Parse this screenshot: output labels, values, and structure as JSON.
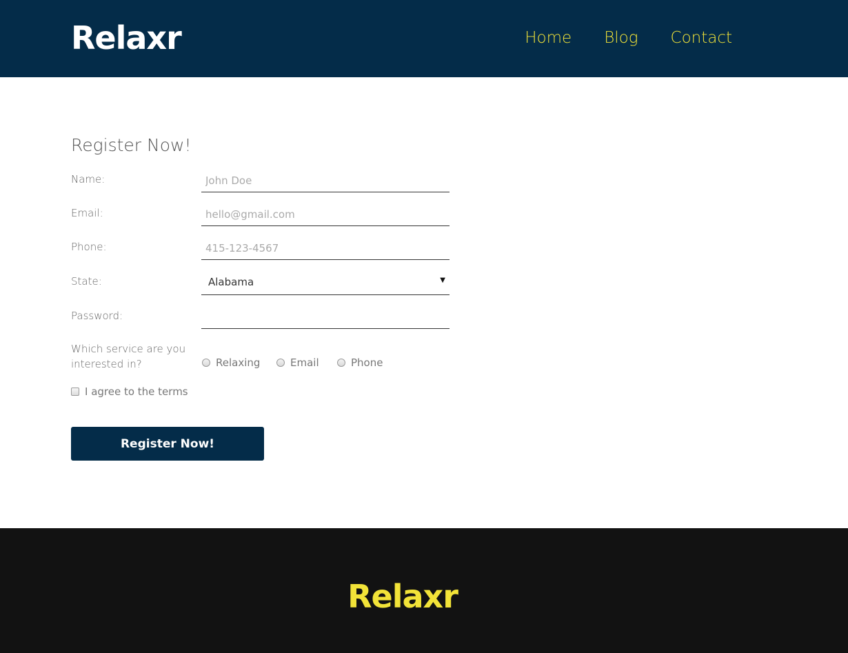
{
  "header": {
    "logo": "Relaxr",
    "nav": [
      "Home",
      "Blog",
      "Contact"
    ]
  },
  "form": {
    "title": "Register Now!",
    "name_label": "Name:",
    "name_placeholder": "John Doe",
    "email_label": "Email:",
    "email_placeholder": "hello@gmail.com",
    "phone_label": "Phone:",
    "phone_placeholder": "415-123-4567",
    "state_label": "State:",
    "state_value": "Alabama",
    "password_label": "Password:",
    "service_label": "Which service are you interested in?",
    "service_options": [
      "Relaxing",
      "Email",
      "Phone"
    ],
    "terms_label": "I agree to the terms",
    "submit_label": "Register Now!"
  },
  "footer": {
    "logo": "Relaxr"
  },
  "colors": {
    "primary": "#042c49",
    "accent": "#f2e338",
    "footer_bg": "#121212"
  }
}
